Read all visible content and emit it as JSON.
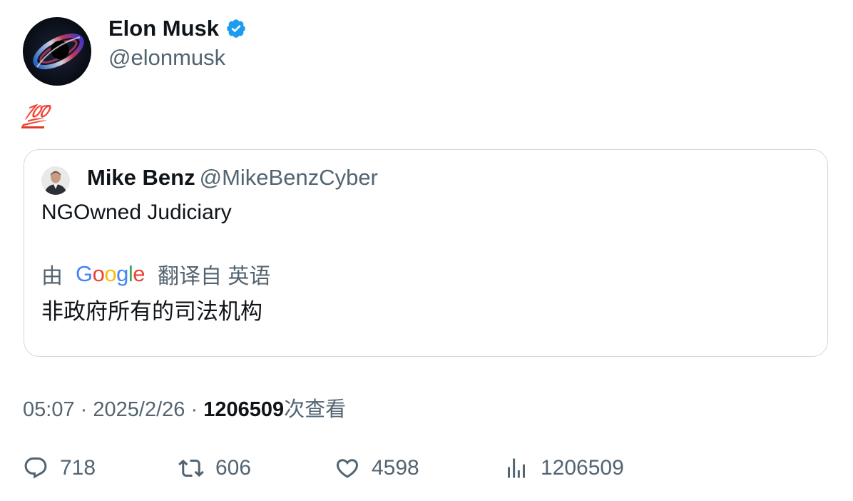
{
  "tweet": {
    "author": {
      "name": "Elon Musk",
      "handle": "@elonmusk",
      "verified": true
    },
    "text": "💯",
    "quote": {
      "author_name": "Mike Benz",
      "author_handle": "@MikeBenzCyber",
      "text": "NGOwned Judiciary",
      "translate_prefix": "由",
      "translate_brand": "Google",
      "translate_suffix": "翻译自 英语",
      "translated_text": "非政府所有的司法机构"
    },
    "meta": {
      "time": "05:07",
      "separator": "·",
      "date": "2025/2/26",
      "views_count": "1206509",
      "views_label": "次查看"
    },
    "actions": {
      "replies": "718",
      "retweets": "606",
      "likes": "4598",
      "views": "1206509"
    }
  },
  "colors": {
    "text_primary": "#0f1419",
    "text_secondary": "#536471",
    "border": "#cfd9de",
    "verified_blue": "#1d9bf0",
    "hundred_red": "#e0392b"
  },
  "icons": {
    "verified": "verified-badge-icon",
    "reply": "reply-icon",
    "retweet": "retweet-icon",
    "like": "like-icon",
    "views": "views-icon"
  }
}
